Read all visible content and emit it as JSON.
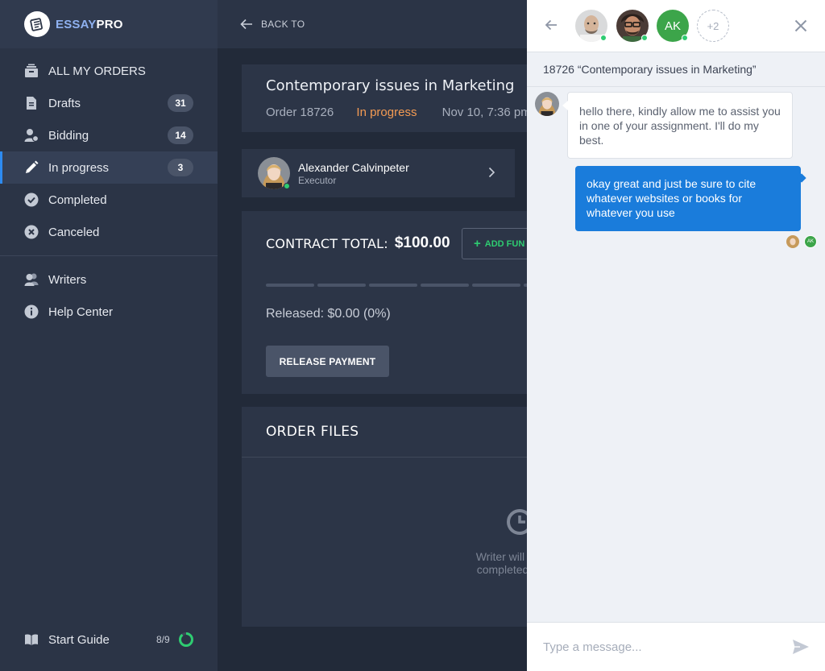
{
  "brand": {
    "name_a": "ESSAY",
    "name_b": "PRO"
  },
  "sidebar": {
    "items": [
      {
        "label": "ALL MY ORDERS",
        "icon": "stack-icon",
        "badge": ""
      },
      {
        "label": "Drafts",
        "icon": "document-icon",
        "badge": "31"
      },
      {
        "label": "Bidding",
        "icon": "user-bid-icon",
        "badge": "14"
      },
      {
        "label": "In progress",
        "icon": "pencil-icon",
        "badge": "3",
        "active": true
      },
      {
        "label": "Completed",
        "icon": "check-circle-icon",
        "badge": ""
      },
      {
        "label": "Canceled",
        "icon": "x-circle-icon",
        "badge": ""
      }
    ],
    "items2": [
      {
        "label": "Writers",
        "icon": "users-icon"
      },
      {
        "label": "Help Center",
        "icon": "info-icon"
      }
    ],
    "guide": {
      "label": "Start Guide",
      "count": "8/9",
      "progress": 0.89
    }
  },
  "main": {
    "back_label": "BACK TO",
    "order": {
      "title": "Contemporary issues in Marketing",
      "number": "Order 18726",
      "status": "In progress",
      "date": "Nov 10, 7:36 pm"
    },
    "executor": {
      "name": "Alexander Calvinpeter",
      "role": "Executor"
    },
    "contract": {
      "label": "CONTRACT TOTAL:",
      "value": "$100.00",
      "add_funds": "ADD FUN",
      "released": "Released: $0.00 (0%)",
      "release_button": "RELEASE PAYMENT"
    },
    "files": {
      "title": "ORDER FILES",
      "empty_line1": "Writer will uploa",
      "empty_line2": "completed orde"
    }
  },
  "chat": {
    "participants_more": "+2",
    "participant_initials": "AK",
    "subject": "18726 “Contemporary issues in Marketing”",
    "messages": [
      {
        "direction": "in",
        "text": "hello there, kindly allow me to assist you in one of your assignment. I'll do my best."
      },
      {
        "direction": "out",
        "text": "okay great and just be sure to cite whatever websites or books for whatever you use"
      }
    ],
    "seen_initials": "AK",
    "input_placeholder": "Type a message..."
  },
  "colors": {
    "accent_blue": "#1a7cdb",
    "status_orange": "#f49b53",
    "online_green": "#2ecc71"
  }
}
